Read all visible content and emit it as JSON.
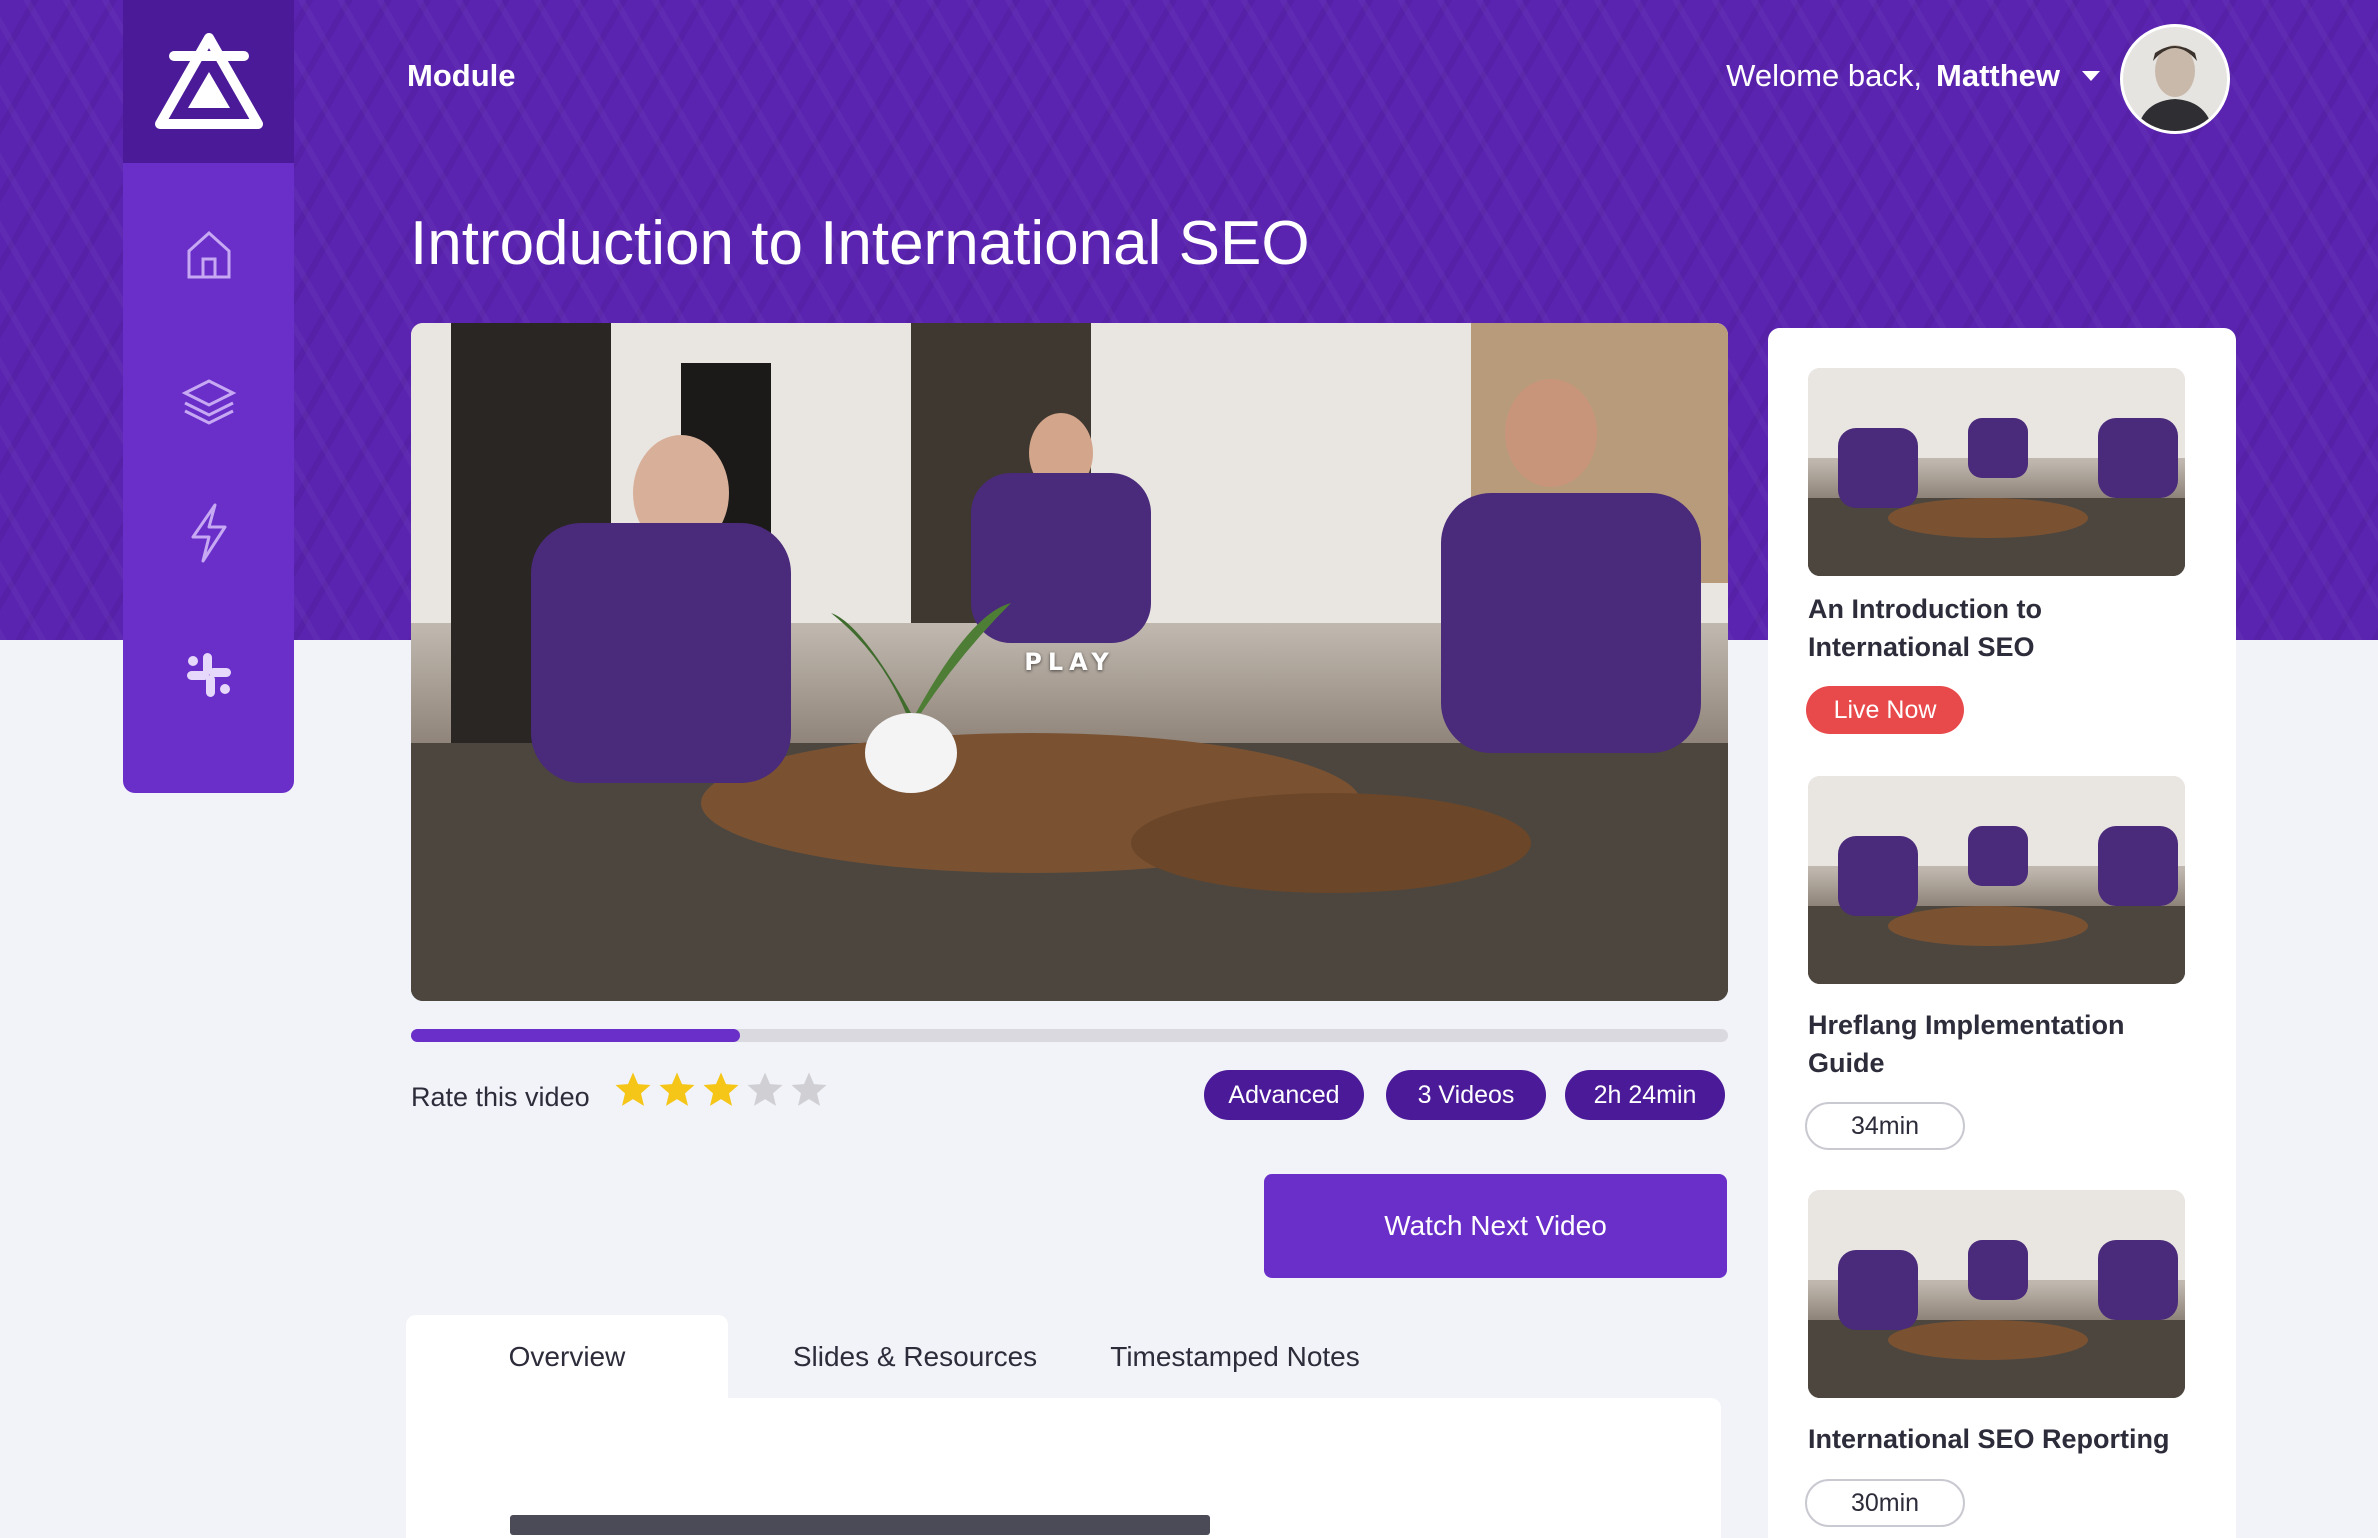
{
  "header": {
    "module_label": "Module",
    "welcome_prefix": "Welome back,",
    "user_name": "Matthew"
  },
  "sidebar": {
    "items": [
      {
        "icon": "home-icon"
      },
      {
        "icon": "layers-icon"
      },
      {
        "icon": "lightning-icon"
      },
      {
        "icon": "slack-icon"
      }
    ]
  },
  "page": {
    "title": "Introduction to International SEO"
  },
  "video": {
    "play_label": "PLAY",
    "progress": 0.25
  },
  "rating": {
    "label": "Rate this video",
    "value": 3,
    "max": 5
  },
  "tags": [
    "Advanced",
    "3 Videos",
    "2h 24min"
  ],
  "actions": {
    "watch_next": "Watch Next Video"
  },
  "tabs": [
    {
      "label": "Overview",
      "active": true
    },
    {
      "label": "Slides & Resources",
      "active": false
    },
    {
      "label": "Timestamped Notes",
      "active": false
    }
  ],
  "playlist": [
    {
      "title": "An Introduction to International SEO",
      "badge": "Live Now",
      "badge_type": "live"
    },
    {
      "title": "Hreflang Implementation Guide",
      "badge": "34min",
      "badge_type": "duration"
    },
    {
      "title": "International SEO Reporting",
      "badge": "30min",
      "badge_type": "duration"
    }
  ],
  "colors": {
    "brand_purple": "#6a2ec9",
    "dark_purple": "#4b1a98",
    "live_red": "#e8494b",
    "star_gold": "#f5c518"
  }
}
